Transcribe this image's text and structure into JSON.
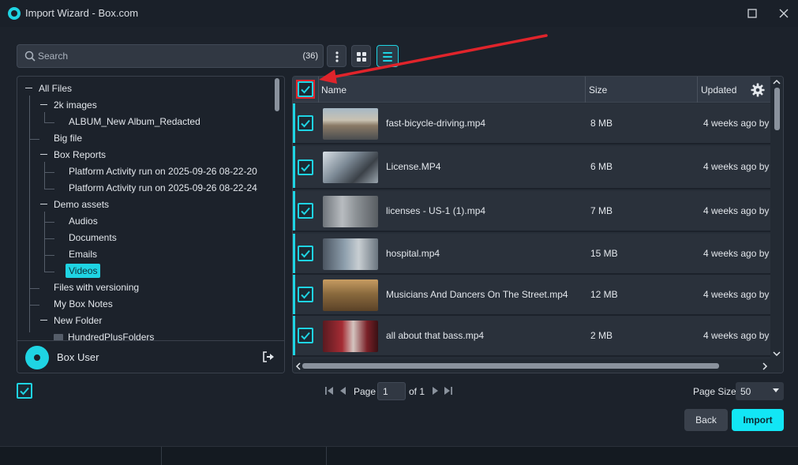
{
  "window": {
    "title": "Import Wizard - Box.com",
    "maximize_icon": "square-icon",
    "close_icon": "close-icon"
  },
  "search": {
    "placeholder": "Search",
    "count": "(36)"
  },
  "toolbar": {
    "more_icon": "vertical-dots-icon",
    "grid_view_icon": "grid-icon",
    "list_view_icon": "list-icon",
    "active_view": "list"
  },
  "tree": {
    "items": [
      {
        "label": "All Files",
        "level": 0,
        "expanded": true
      },
      {
        "label": "2k images",
        "level": 1,
        "expanded": true
      },
      {
        "label": "ALBUM_New Album_Redacted",
        "level": 2
      },
      {
        "label": "Big file",
        "level": 1
      },
      {
        "label": "Box Reports",
        "level": 1,
        "expanded": true
      },
      {
        "label": "Platform Activity run on 2025-09-26 08-22-20",
        "level": 2
      },
      {
        "label": "Platform Activity run on 2025-09-26 08-22-24",
        "level": 2
      },
      {
        "label": "Demo assets",
        "level": 1,
        "expanded": true
      },
      {
        "label": "Audios",
        "level": 2
      },
      {
        "label": "Documents",
        "level": 2
      },
      {
        "label": "Emails",
        "level": 2
      },
      {
        "label": "Videos",
        "level": 2,
        "selected": true
      },
      {
        "label": "Files with versioning",
        "level": 1
      },
      {
        "label": "My Box Notes",
        "level": 1
      },
      {
        "label": "New Folder",
        "level": 1,
        "expanded": true
      },
      {
        "label": "HundredPlusFolders",
        "level": 2
      }
    ]
  },
  "user": {
    "name": "Box User",
    "logout_icon": "logout-icon"
  },
  "grid": {
    "columns": {
      "name": "Name",
      "size": "Size",
      "updated": "Updated"
    },
    "header_checked": true,
    "rows": [
      {
        "name": "fast-bicycle-driving.mp4",
        "size": "8 MB",
        "updated": "4 weeks ago by",
        "checked": true,
        "thumb": "road-scene"
      },
      {
        "name": "License.MP4",
        "size": "6 MB",
        "updated": "4 weeks ago by",
        "checked": true,
        "thumb": "car-interior"
      },
      {
        "name": "licenses - US-1 (1).mp4",
        "size": "7 MB",
        "updated": "4 weeks ago by",
        "checked": true,
        "thumb": "city-street"
      },
      {
        "name": "hospital.mp4",
        "size": "15 MB",
        "updated": "4 weeks ago by",
        "checked": true,
        "thumb": "lab"
      },
      {
        "name": "Musicians And Dancers On The Street.mp4",
        "size": "12 MB",
        "updated": "4 weeks ago by",
        "checked": true,
        "thumb": "street-crowd"
      },
      {
        "name": "all about that bass.mp4",
        "size": "2 MB",
        "updated": "4 weeks ago by",
        "checked": true,
        "thumb": "performers"
      }
    ]
  },
  "pagination": {
    "page_label": "Page",
    "page_value": "1",
    "of_label": "of 1",
    "page_size_label": "Page Size",
    "page_size_value": "50"
  },
  "buttons": {
    "back": "Back",
    "import": "Import"
  },
  "colors": {
    "accent": "#1fd4e3",
    "import_button": "#12e6f5",
    "annotation": "#e0242b",
    "background": "#1c222b"
  }
}
